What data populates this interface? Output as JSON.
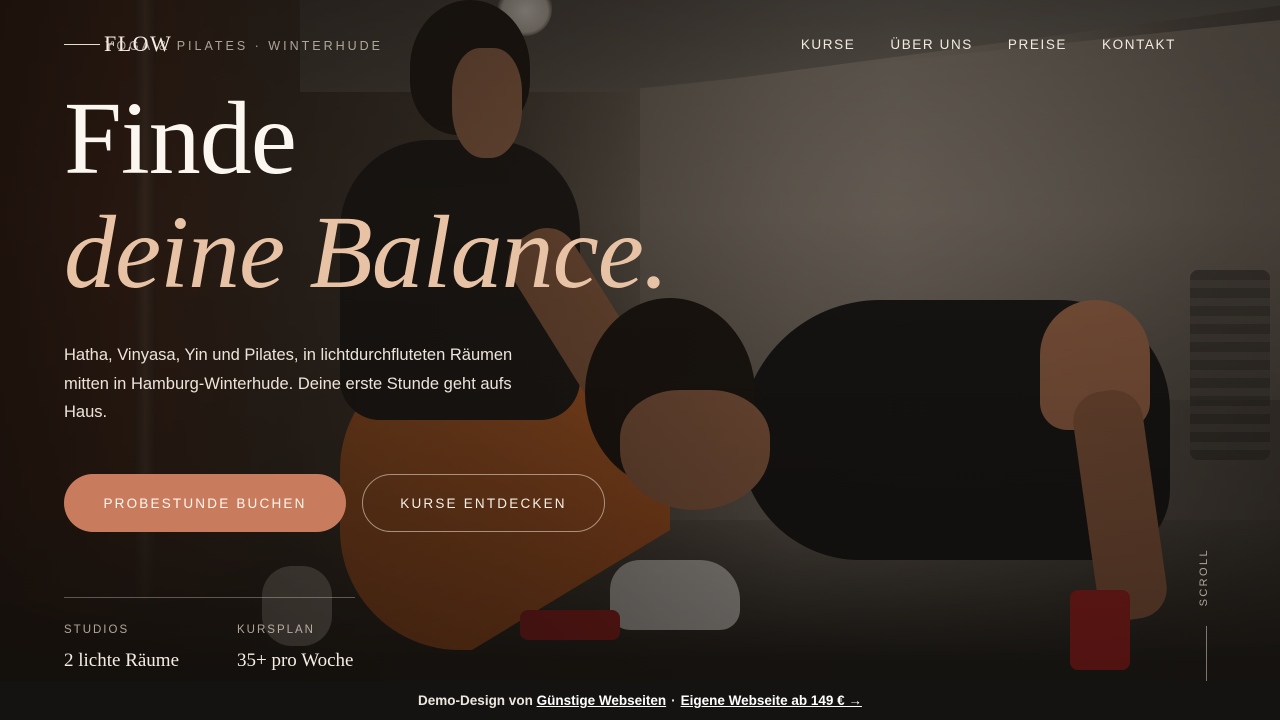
{
  "brand": {
    "logo": "FLOW",
    "tagline": "YOGA & PILATES · WINTERHUDE"
  },
  "nav": {
    "items": [
      "KURSE",
      "ÜBER UNS",
      "PREISE",
      "KONTAKT"
    ]
  },
  "hero": {
    "headline_line1": "Finde",
    "headline_line2": "deine Balance.",
    "lead": "Hatha, Vinyasa, Yin und Pilates, in lichtdurchfluteten Räumen mitten in Hamburg-Winterhude. Deine erste Stunde geht aufs Haus.",
    "primary_button": "PROBESTUNDE BUCHEN",
    "secondary_button": "KURSE ENTDECKEN"
  },
  "stats": [
    {
      "label": "STUDIOS",
      "value": "2 lichte Räume"
    },
    {
      "label": "KURSPLAN",
      "value": "35+ pro Woche"
    }
  ],
  "scroll_label": "SCROLL",
  "demo_bar": {
    "prefix": "Demo-Design von",
    "link1": "Günstige Webseiten",
    "separator": "·",
    "link2": "Eigene Webseite ab 149 € →"
  },
  "colors": {
    "accent": "#c97c5d",
    "headline_italic": "#e8c2a4",
    "demo_bar_bg": "#151311"
  }
}
